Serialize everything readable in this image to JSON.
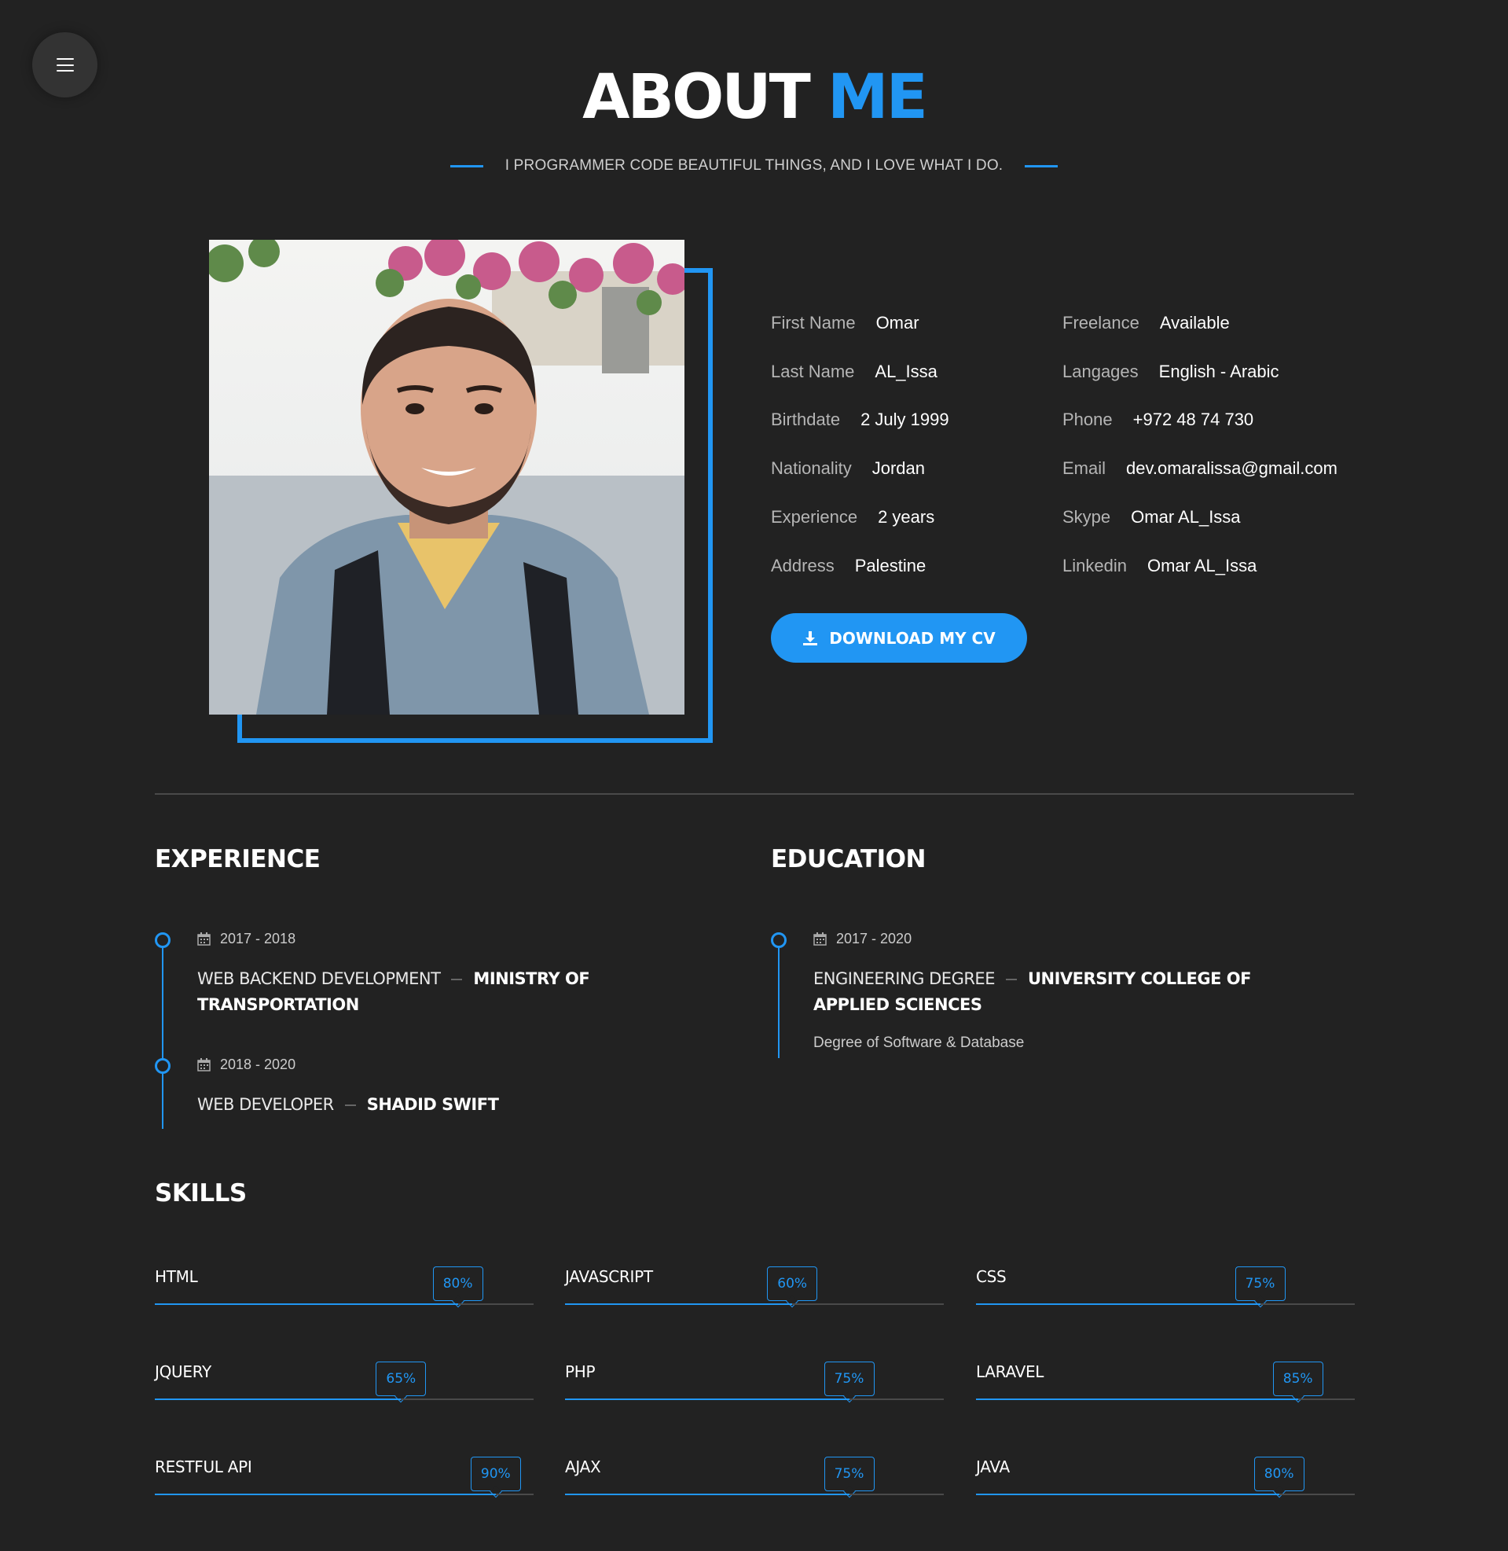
{
  "header": {
    "title_main": "ABOUT",
    "title_accent": "ME",
    "subtitle": "I PROGRAMMER CODE BEAUTIFUL THINGS, AND I LOVE WHAT I DO."
  },
  "menu": {
    "icon": "hamburger-menu-icon"
  },
  "colors": {
    "accent": "#2196f3",
    "background": "#222222"
  },
  "profile_photo": {
    "icon": "profile-photo"
  },
  "info": {
    "left": [
      {
        "label": "First Name",
        "value": "Omar"
      },
      {
        "label": "Last Name",
        "value": "AL_Issa"
      },
      {
        "label": "Birthdate",
        "value": "2 July 1999"
      },
      {
        "label": "Nationality",
        "value": "Jordan"
      },
      {
        "label": "Experience",
        "value": "2 years"
      },
      {
        "label": "Address",
        "value": "Palestine"
      }
    ],
    "right": [
      {
        "label": "Freelance",
        "value": "Available"
      },
      {
        "label": "Langages",
        "value": "English - Arabic"
      },
      {
        "label": "Phone",
        "value": "+972 48 74 730"
      },
      {
        "label": "Email",
        "value": "dev.omaralissa@gmail.com"
      },
      {
        "label": "Skype",
        "value": "Omar AL_Issa"
      },
      {
        "label": "Linkedin",
        "value": "Omar AL_Issa"
      }
    ]
  },
  "cv_button": {
    "label": "DOWNLOAD MY CV",
    "icon": "download-icon"
  },
  "experience": {
    "title": "EXPERIENCE",
    "items": [
      {
        "date": "2017 - 2018",
        "role": "WEB BACKEND DEVELOPMENT",
        "org": "MINISTRY OF TRANSPORTATION"
      },
      {
        "date": "2018 - 2020",
        "role": "WEB DEVELOPER",
        "org": "SHADID SWIFT"
      }
    ]
  },
  "education": {
    "title": "EDUCATION",
    "items": [
      {
        "date": "2017 - 2020",
        "role": "ENGINEERING DEGREE",
        "org": "UNIVERSITY COLLEGE OF APPLIED SCIENCES",
        "desc": "Degree of Software & Database"
      }
    ]
  },
  "skills": {
    "title": "SKILLS",
    "items": [
      {
        "name": "HTML",
        "percent": 80,
        "label": "80%"
      },
      {
        "name": "JAVASCRIPT",
        "percent": 60,
        "label": "60%"
      },
      {
        "name": "CSS",
        "percent": 75,
        "label": "75%"
      },
      {
        "name": "JQUERY",
        "percent": 65,
        "label": "65%"
      },
      {
        "name": "PHP",
        "percent": 75,
        "label": "75%"
      },
      {
        "name": "LARAVEL",
        "percent": 85,
        "label": "85%"
      },
      {
        "name": "RESTFUL API",
        "percent": 90,
        "label": "90%"
      },
      {
        "name": "AJAX",
        "percent": 75,
        "label": "75%"
      },
      {
        "name": "JAVA",
        "percent": 80,
        "label": "80%"
      }
    ]
  }
}
